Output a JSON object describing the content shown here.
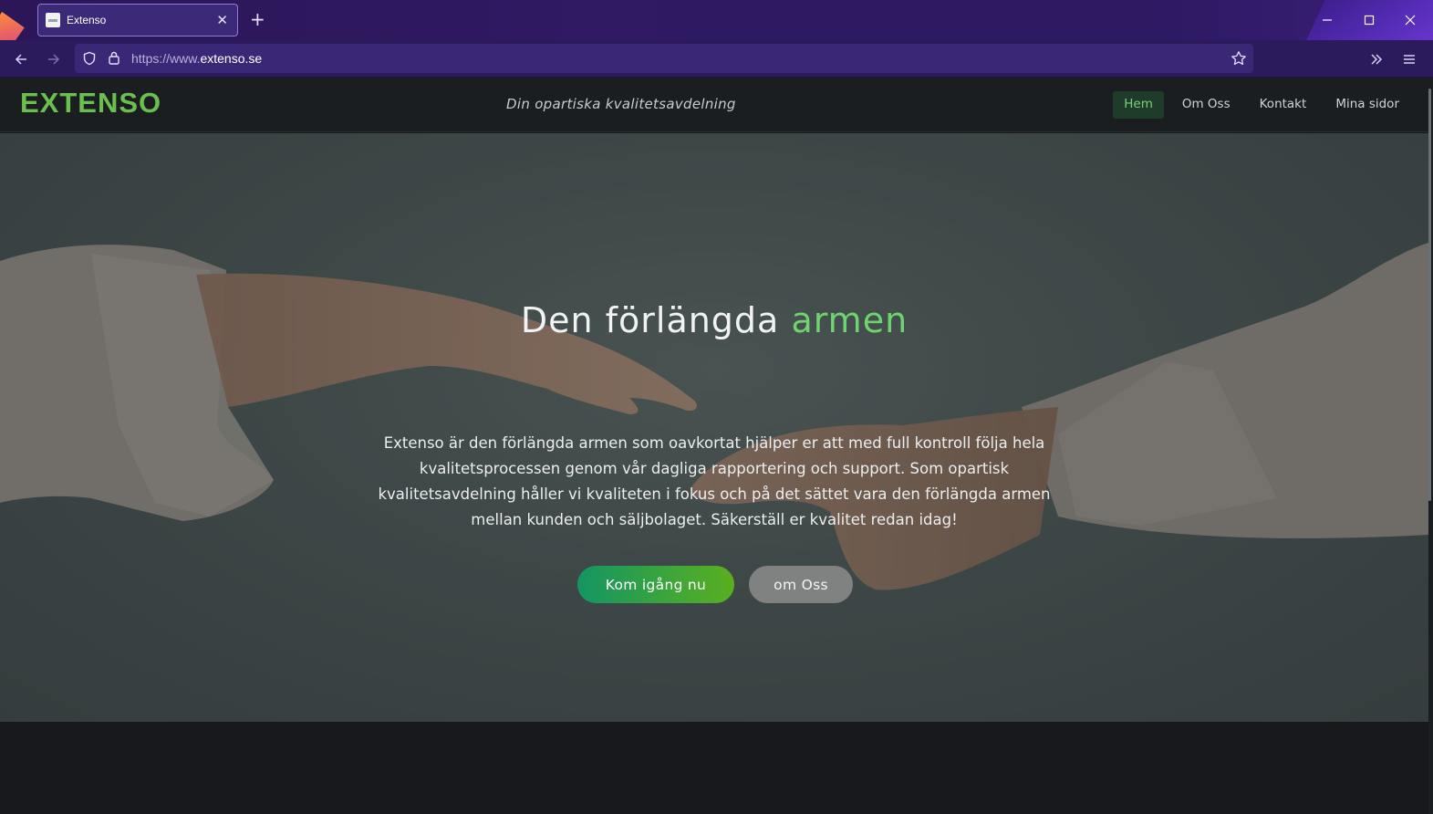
{
  "browser": {
    "tab_title": "Extenso",
    "new_tab_symbol": "+",
    "url_scheme": "https://www.",
    "url_host": "extenso.se"
  },
  "site": {
    "logo": "EXTENSO",
    "tagline": "Din opartiska kvalitetsavdelning",
    "nav": [
      {
        "label": "Hem",
        "active": true
      },
      {
        "label": "Om Oss",
        "active": false
      },
      {
        "label": "Kontakt",
        "active": false
      },
      {
        "label": "Mina sidor",
        "active": false
      }
    ]
  },
  "hero": {
    "title_main": "Den förlängda",
    "title_accent": "armen",
    "body": "Extenso är den förlängda armen som oavkortat hjälper er att med full kontroll följa hela kvalitetsprocessen genom vår dagliga rapportering och support. Som opartisk kvalitetsavdelning håller vi kvaliteten i fokus och på det sättet vara den förlängda armen mellan kunden och säljbolaget. Säkerställ er kvalitet redan idag!",
    "primary_button": "Kom igång nu",
    "secondary_button": "om Oss"
  },
  "colors": {
    "brand_green": "#6bbf4e",
    "accent_green": "#6fd36f",
    "browser_purple": "#2b1a5c"
  }
}
